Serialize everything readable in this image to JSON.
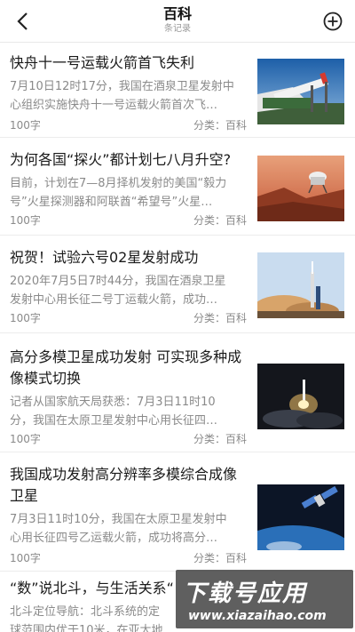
{
  "header": {
    "title": "百科",
    "subtitle": "条记录"
  },
  "items": [
    {
      "title": "快舟十一号运载火箭首飞失利",
      "desc_lines": [
        "7月10日12时17分，我国在酒泉卫星发射中",
        "心组织实施快舟十一号运载火箭首次飞…"
      ],
      "words": "100字",
      "category": "分类：百科"
    },
    {
      "title": "为何各国“探火”都计划七八月升空?",
      "desc_lines": [
        "目前，计划在7—8月择机发射的美国“毅力",
        "号”火星探测器和阿联酋“希望号”火星…"
      ],
      "words": "100字",
      "category": "分类：百科"
    },
    {
      "title": "祝贺！试验六号02星发射成功",
      "desc_lines": [
        "2020年7月5日7时44分，我国在酒泉卫星",
        "发射中心用长征二号丁运载火箭，成功…"
      ],
      "words": "100字",
      "category": "分类：百科"
    },
    {
      "title_lines": [
        "高分多模卫星成功发射 可实现多种成",
        "像模式切换"
      ],
      "desc_lines": [
        "记者从国家航天局获悉：7月3日11时10",
        "分，我国在太原卫星发射中心用长征四…"
      ],
      "words": "100字",
      "category": "分类：百科"
    },
    {
      "title_lines": [
        "我国成功发射高分辨率多模综合成像",
        "卫星"
      ],
      "desc_lines": [
        "7月3日11时10分，我国在太原卫星发射中",
        "心用长征四号乙运载火箭，成功将高分…"
      ],
      "words": "100字",
      "category": "分类：百科"
    },
    {
      "title": "“数”说北斗，与生活关系“",
      "desc_lines": [
        "北斗定位导航：北斗系统的定",
        "球范围内优于10米，在亚太地"
      ]
    }
  ],
  "watermark": {
    "main": "下载号应用",
    "url": "www.xiazaihao.com"
  },
  "colors": {
    "text_primary": "#1a1a1a",
    "text_secondary": "#8a8a8a",
    "divider": "#ececec"
  }
}
